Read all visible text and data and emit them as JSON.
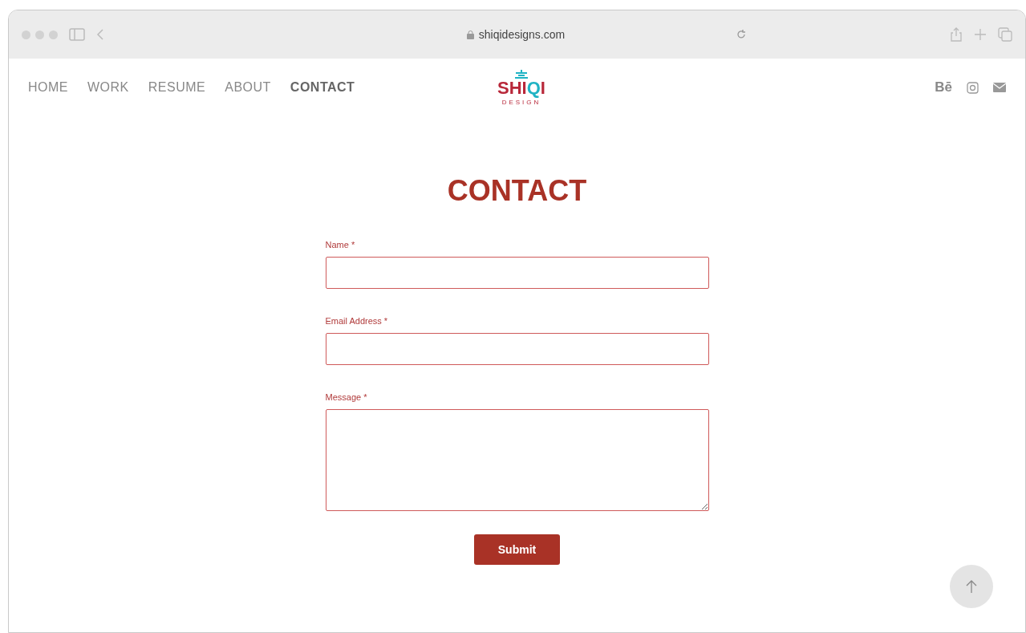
{
  "browser": {
    "url": "shiqidesigns.com"
  },
  "nav": [
    {
      "label": "HOME",
      "selected": false
    },
    {
      "label": "WORK",
      "selected": false
    },
    {
      "label": "RESUME",
      "selected": false
    },
    {
      "label": "ABOUT",
      "selected": false
    },
    {
      "label": "CONTACT",
      "selected": true
    }
  ],
  "logo": {
    "parts": [
      {
        "text": "SHI",
        "color": "#b8283a"
      },
      {
        "text": "Q",
        "color": "#1fb3c4"
      },
      {
        "text": "I",
        "color": "#b8283a"
      }
    ],
    "tagline": "DESIGN"
  },
  "social": {
    "behance": "Bē"
  },
  "page": {
    "title": "CONTACT"
  },
  "form": {
    "fields": [
      {
        "label": "Name *",
        "kind": "input"
      },
      {
        "label": "Email Address *",
        "kind": "input"
      },
      {
        "label": "Message *",
        "kind": "textarea"
      }
    ],
    "submit": "Submit"
  }
}
